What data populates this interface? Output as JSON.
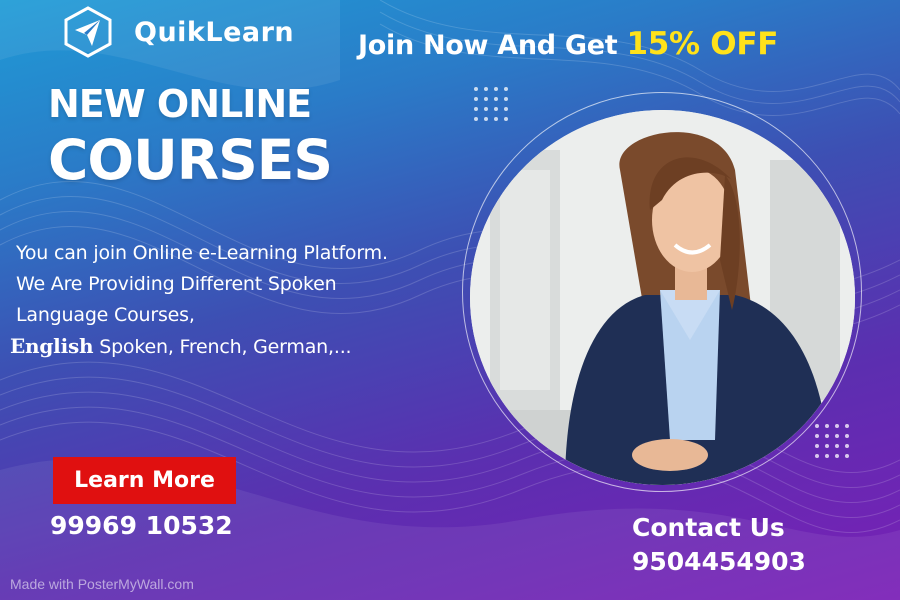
{
  "brand": {
    "name": "QuikLearn",
    "logo_icon": "paper-plane-hexagon-icon"
  },
  "promo": {
    "text": "Join Now And Get",
    "highlight": "15% OFF",
    "highlight_color": "#ffe21a"
  },
  "headline": {
    "line1": "NEW ONLINE",
    "line2": "COURSES"
  },
  "description": {
    "line1": "You can join Online e-Learning Platform.",
    "line2": "We Are Providing Different Spoken",
    "line3": "Language Courses,",
    "line4_lead": "English",
    "line4_rest": " Spoken, French, German,..."
  },
  "cta": {
    "learn_more": "Learn More",
    "button_color": "#e01010"
  },
  "phone_left": "99969 10532",
  "contact": {
    "title": "Contact Us",
    "phone": "9504454903"
  },
  "watermark": "Made with PosterMyWall.com",
  "colors": {
    "gradient_top": "#1f9bd6",
    "gradient_bottom": "#7a1fb6"
  }
}
